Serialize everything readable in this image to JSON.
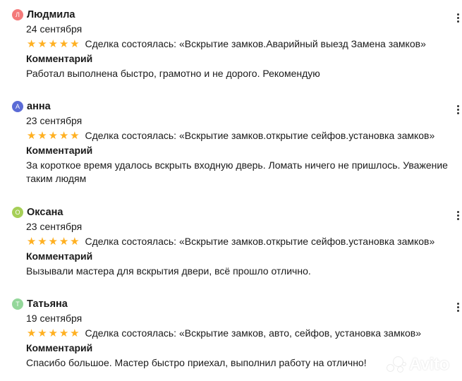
{
  "reviews": [
    {
      "avatar_letter": "Л",
      "avatar_color": "#f47a7a",
      "name": "Людмила",
      "date": "24 сентября",
      "rating": 5,
      "deal": "Сделка состоялась: «Вскрытие замков.Аварийный выезд Замена замков»",
      "comment_label": "Комментарий",
      "comment": "Работал выполнена быстро, грамотно и не дорого. Рекомендую"
    },
    {
      "avatar_letter": "А",
      "avatar_color": "#5b6bd6",
      "name": "анна",
      "date": "23 сентября",
      "rating": 5,
      "deal": "Сделка состоялась: «Вскрытие замков.открытие сейфов.установка замков»",
      "comment_label": "Комментарий",
      "comment": "За короткое время удалось вскрыть входную дверь. Ломать ничего не пришлось. Уважение таким людям"
    },
    {
      "avatar_letter": "О",
      "avatar_color": "#a6cf57",
      "name": "Оксана",
      "date": "23 сентября",
      "rating": 5,
      "deal": "Сделка состоялась: «Вскрытие замков.открытие сейфов.установка замков»",
      "comment_label": "Комментарий",
      "comment": "Вызывали мастера для вскрытия двери, всё прошло отлично."
    },
    {
      "avatar_letter": "Т",
      "avatar_color": "#94d79a",
      "name": "Татьяна",
      "date": "19 сентября",
      "rating": 5,
      "deal": "Сделка состоялась: «Вскрытие замков, авто, сейфов, установка замков»",
      "comment_label": "Комментарий",
      "comment": "Спасибо большое. Мастер быстро приехал, выполнил работу на отлично!"
    }
  ],
  "icons": {
    "star": "star-icon",
    "menu": "more-vertical-icon"
  },
  "colors": {
    "star": "#ffb021",
    "text": "#1a1a1a"
  },
  "watermark": {
    "text": "Avito"
  }
}
